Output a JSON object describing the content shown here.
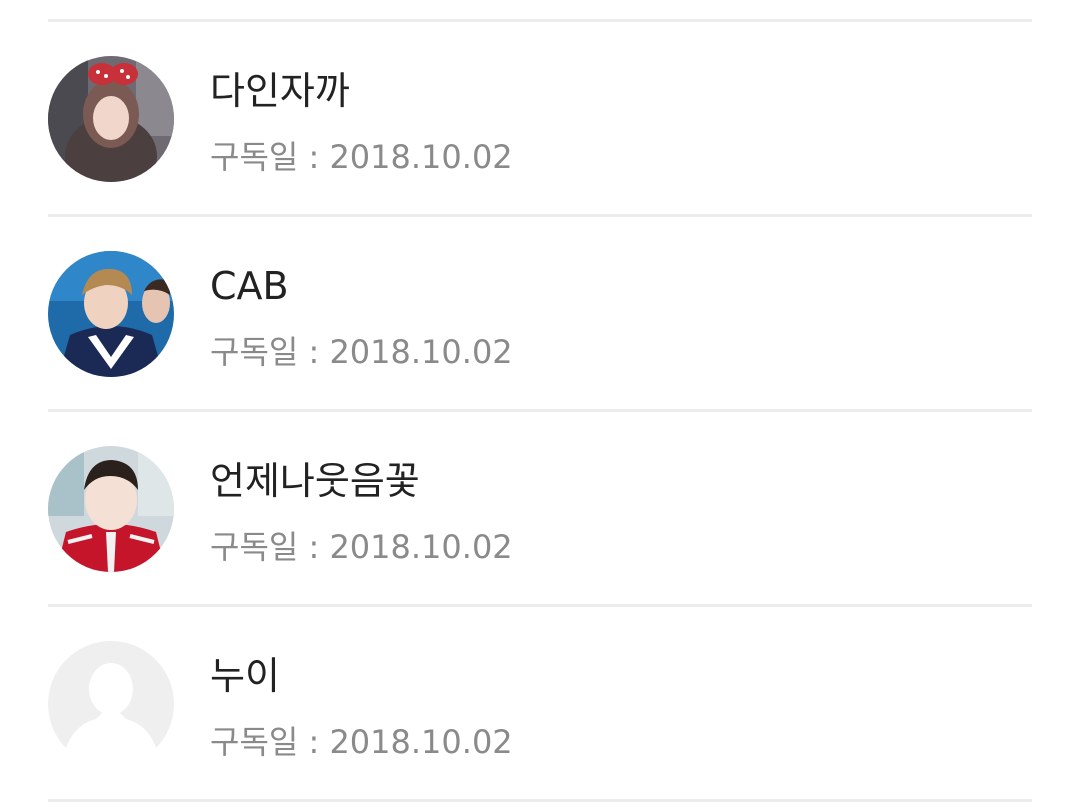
{
  "subscribers": [
    {
      "name": "다인자까",
      "date_label": "구독일 : 2018.10.02",
      "avatar": "photo-girl-headband"
    },
    {
      "name": "CAB",
      "date_label": "구독일 : 2018.10.02",
      "avatar": "photo-boy-uniform"
    },
    {
      "name": "언제나웃음꽃",
      "date_label": "구독일 : 2018.10.02",
      "avatar": "photo-boy-red-jacket"
    },
    {
      "name": "누이",
      "date_label": "구독일 : 2018.10.02",
      "avatar": "default-user-icon"
    }
  ]
}
